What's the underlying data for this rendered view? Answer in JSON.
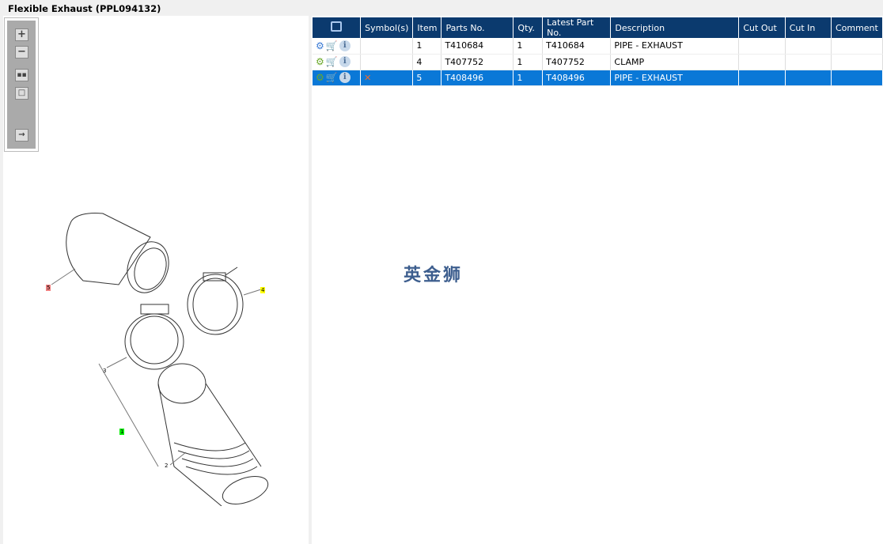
{
  "title": "Flexible Exhaust (PPL094132)",
  "toolbar": {
    "zoom_in": "zoom-in",
    "zoom_out": "zoom-out",
    "fit": "fit",
    "reset": "reset",
    "export": "export"
  },
  "watermark": "英金狮",
  "diagram": {
    "callouts": [
      {
        "label": "5",
        "color": "#f08080"
      },
      {
        "label": "4",
        "color": "#ffff00"
      },
      {
        "label": "3"
      },
      {
        "label": "1",
        "color": "#00e000"
      },
      {
        "label": "2"
      }
    ]
  },
  "table": {
    "headers": [
      "",
      "Symbol(s)",
      "Item",
      "Parts No.",
      "Qty.",
      "Latest Part No.",
      "Description",
      "Cut Out",
      "Cut In",
      "Comment"
    ],
    "rows": [
      {
        "item": "1",
        "parts_no": "T410684",
        "qty": "1",
        "latest": "T410684",
        "desc": "PIPE - EXHAUST",
        "symbol": "",
        "cut_out": "",
        "cut_in": "",
        "comment": "",
        "selected": false
      },
      {
        "item": "4",
        "parts_no": "T407752",
        "qty": "1",
        "latest": "T407752",
        "desc": "CLAMP",
        "symbol": "",
        "cut_out": "",
        "cut_in": "",
        "comment": "",
        "selected": false
      },
      {
        "item": "5",
        "parts_no": "T408496",
        "qty": "1",
        "latest": "T408496",
        "desc": "PIPE - EXHAUST",
        "symbol": "✕",
        "cut_out": "",
        "cut_in": "",
        "comment": "",
        "selected": true
      }
    ],
    "info_glyph": "i"
  }
}
